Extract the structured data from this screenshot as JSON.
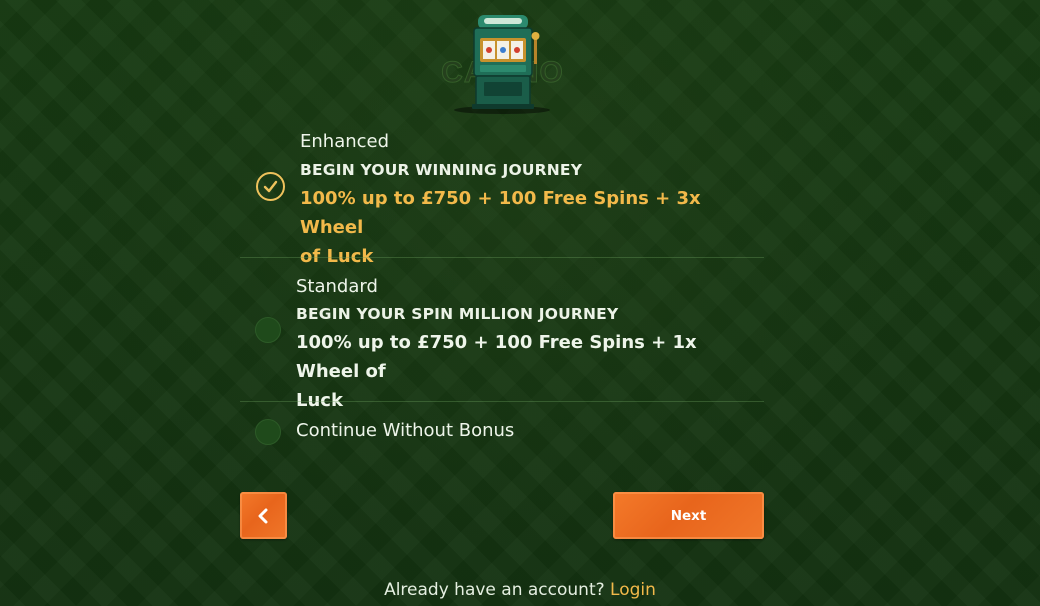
{
  "logo": {
    "wordmark": "CASINO"
  },
  "bonus_options": [
    {
      "tier": "Enhanced",
      "headline": "BEGIN YOUR WINNING JOURNEY",
      "offer_line1": "100% up to £750 + 100 Free Spins + 3x Wheel",
      "offer_line2": "of Luck",
      "selected": true
    },
    {
      "tier": "Standard",
      "headline": "BEGIN YOUR SPIN MILLION JOURNEY",
      "offer_line1": "100% up to £750 + 100 Free Spins + 1x Wheel of",
      "offer_line2": "Luck",
      "selected": false
    },
    {
      "label": "Continue Without Bonus",
      "selected": false
    }
  ],
  "buttons": {
    "back_icon": "chevron-left-icon",
    "next_label": "Next"
  },
  "footer": {
    "prompt": "Already have an account?",
    "login_label": "Login"
  },
  "colors": {
    "accent_gold": "#f2b94a",
    "button_orange": "#ee6f22",
    "background_green": "#163711"
  }
}
